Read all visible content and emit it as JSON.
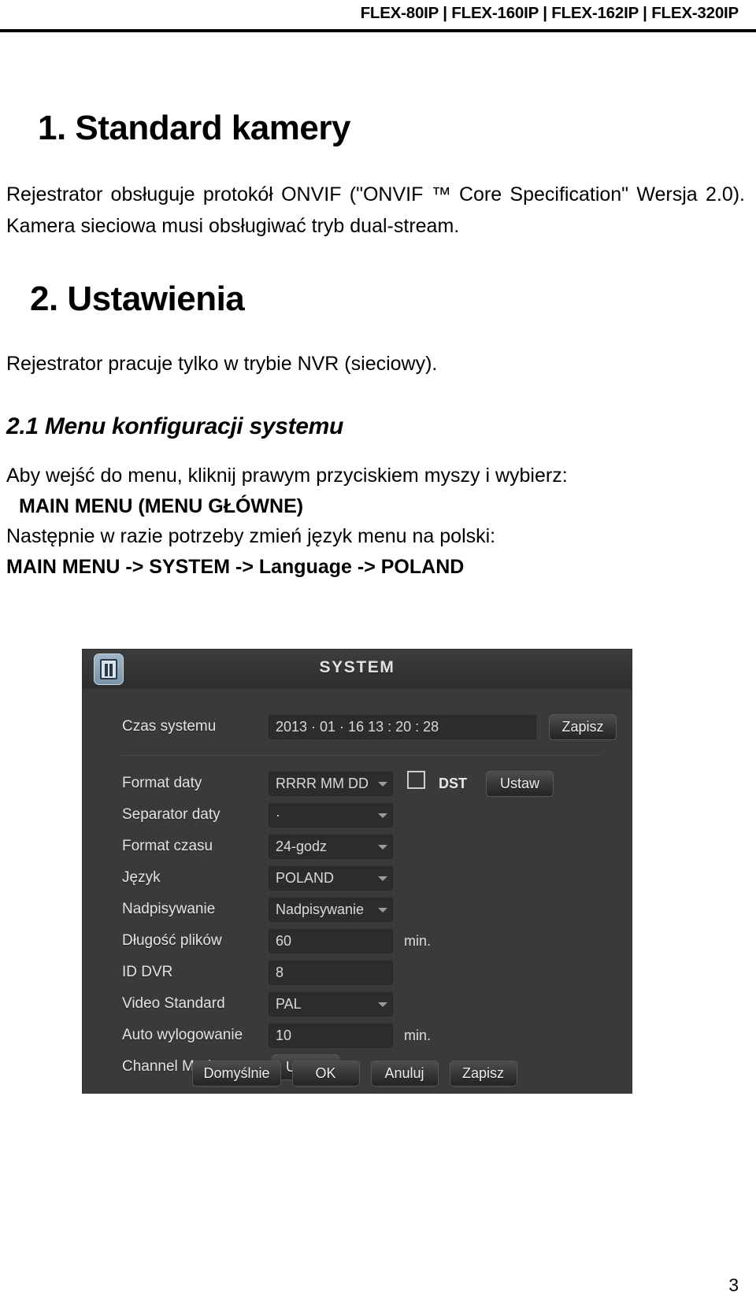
{
  "header": {
    "models": "FLEX-80IP | FLEX-160IP | FLEX-162IP | FLEX-320IP"
  },
  "sections": {
    "h1_first": "1. Standard kamery",
    "para_first": "Rejestrator obsługuje protokół ONVIF (\"ONVIF ™ Core Specification\" Wersja 2.0). Kamera sieciowa musi obsługiwać tryb dual-stream.",
    "h1_second": "2. Ustawienia",
    "para_second": "Rejestrator pracuje tylko w trybie NVR (sieciowy).",
    "h2": "2.1 Menu konfiguracji systemu",
    "line1": "Aby wejść do menu, kliknij prawym przyciskiem myszy i wybierz:",
    "line2": "MAIN MENU (MENU GŁÓWNE)",
    "line3": "Następnie w razie potrzeby zmień język menu na polski:",
    "line4": "MAIN MENU -> SYSTEM -> Language -> POLAND"
  },
  "dvr": {
    "title": "SYSTEM",
    "icon": "system-settings-icon",
    "rows": [
      {
        "label": "Czas systemu",
        "value": "2013 · 01 · 16   13 : 20 : 28",
        "kind": "text-wide"
      },
      {
        "label": "Format daty",
        "value": "RRRR MM DD",
        "kind": "select"
      },
      {
        "label": "Separator daty",
        "value": "·",
        "kind": "select"
      },
      {
        "label": "Format czasu",
        "value": "24-godz",
        "kind": "select"
      },
      {
        "label": "Język",
        "value": "POLAND",
        "kind": "select"
      },
      {
        "label": "Nadpisywanie",
        "value": "Nadpisywanie",
        "kind": "select"
      },
      {
        "label": "Długość plików",
        "value": "60",
        "kind": "input",
        "unit": "min."
      },
      {
        "label": "ID DVR",
        "value": "8",
        "kind": "input",
        "unit": ""
      },
      {
        "label": "Video Standard",
        "value": "PAL",
        "kind": "select"
      },
      {
        "label": "Auto wylogowanie",
        "value": "10",
        "kind": "input",
        "unit": "min."
      },
      {
        "label": "Channel Mode",
        "value": "",
        "kind": "button"
      }
    ],
    "save_time_button": "Zapisz",
    "dst_label": "DST",
    "dst_checked": false,
    "dst_button": "Ustaw",
    "channel_mode_button": "Ustaw",
    "footer_buttons": [
      "Domyślnie",
      "OK",
      "Anuluj",
      "Zapisz"
    ],
    "colors": {
      "panel_bg": "#3a3a3a",
      "field_bg": "#2c2c2c",
      "text": "#e3e3e3",
      "icon_accent": "#9fb6c8"
    }
  },
  "page_number": "3"
}
